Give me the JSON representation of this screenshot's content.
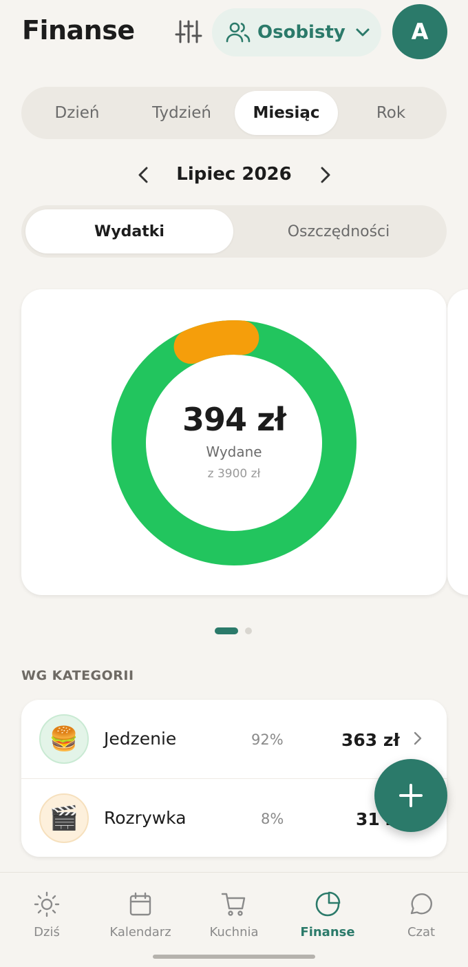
{
  "header": {
    "title": "Finanse",
    "profile_label": "Osobisty",
    "avatar_initial": "A"
  },
  "period_tabs": [
    "Dzień",
    "Tydzień",
    "Miesiąc",
    "Rok"
  ],
  "period_active": "Miesiąc",
  "month_nav": {
    "label": "Lipiec 2026"
  },
  "type_tabs": {
    "expenses": "Wydatki",
    "savings": "Oszczędności",
    "active": "Wydatki"
  },
  "summary": {
    "amount": "394 zł",
    "label": "Wydane",
    "budget": "z 3900 zł"
  },
  "chart_data": {
    "type": "pie",
    "categories": [
      "Jedzenie",
      "Rozrywka"
    ],
    "values": [
      363,
      31
    ],
    "colors": [
      "#22c55e",
      "#f59e0b"
    ]
  },
  "carousel": {
    "pages": 2,
    "active": 1
  },
  "categories_section": {
    "title": "WG KATEGORII",
    "items": [
      {
        "name": "Jedzenie",
        "percent": "92%",
        "amount": "363 zł",
        "emoji": "🍔",
        "bg": "#e3f4e8",
        "ring": "#c9ead3"
      },
      {
        "name": "Rozrywka",
        "percent": "8%",
        "amount": "31 zł",
        "emoji": "🎬",
        "bg": "#fdf0dc",
        "ring": "#f6e0bd"
      }
    ]
  },
  "nav": {
    "items": [
      "Dziś",
      "Kalendarz",
      "Kuchnia",
      "Finanse",
      "Czat"
    ],
    "active": "Finanse"
  },
  "colors": {
    "accent": "#2b7a6a",
    "spent_green": "#22c55e",
    "spent_orange": "#f59e0b"
  }
}
